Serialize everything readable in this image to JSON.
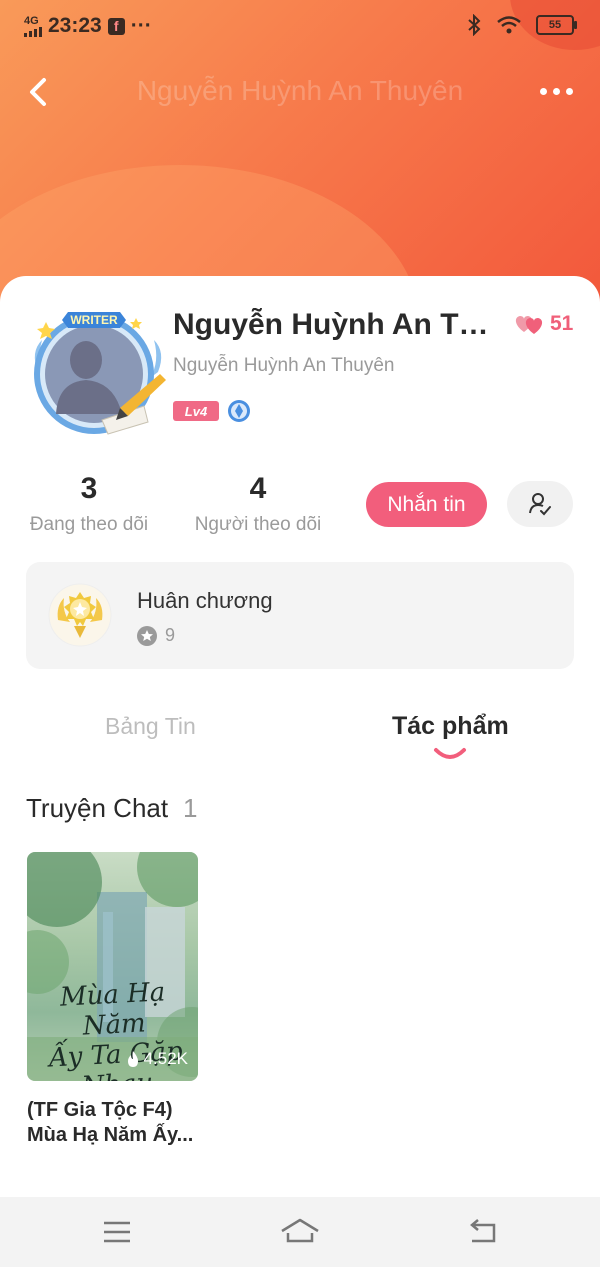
{
  "status_bar": {
    "network": "4G",
    "time": "23:23",
    "app_badge": "f",
    "more": "···",
    "battery": "55"
  },
  "nav": {
    "title": "Nguyễn Huỳnh An Thuyên",
    "back_icon": "chevron-left-icon",
    "more_icon": "more-horizontal-icon"
  },
  "profile": {
    "display_name": "Nguyễn Huỳnh An Thuyên",
    "display_name_truncated": "Nguyễn Huỳnh An Thu...",
    "likes": "51",
    "username": "Nguyễn Huỳnh An Thuyên",
    "level": "Lv4",
    "avatar_badge": "WRITER"
  },
  "stats": {
    "following_count": "3",
    "following_label": "Đang theo dõi",
    "followers_count": "4",
    "followers_label": "Người theo dõi"
  },
  "actions": {
    "message_label": "Nhắn tin",
    "follow_icon": "user-check-icon"
  },
  "medals": {
    "title": "Huân chương",
    "count": "9"
  },
  "tabs": [
    {
      "label": "Bảng Tin",
      "active": false
    },
    {
      "label": "Tác phẩm",
      "active": true
    }
  ],
  "section": {
    "title": "Truyện Chat",
    "count": "1"
  },
  "stories": [
    {
      "cover_text_line1": "Mùa Hạ Năm",
      "cover_text_line2": "Ấy Ta Gặp Nhau",
      "views": "4.52K",
      "title_line1": "(TF Gia Tộc F4)",
      "title_line2": "Mùa Hạ Năm Ấy..."
    }
  ],
  "colors": {
    "header_gradient_start": "#f99a59",
    "header_gradient_end": "#f2573b",
    "accent_pink": "#f25e7c",
    "level_badge": "#f06a86"
  }
}
